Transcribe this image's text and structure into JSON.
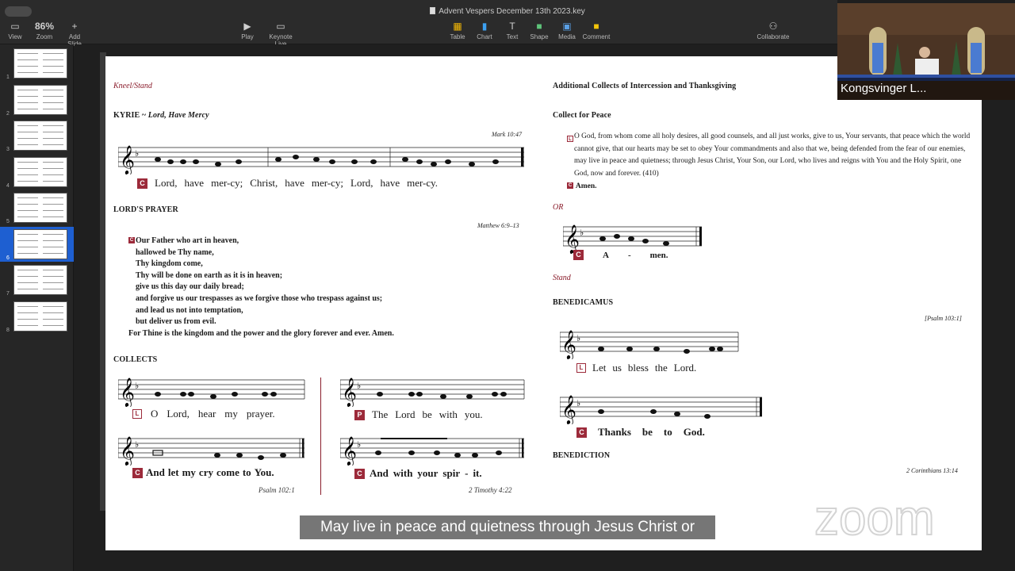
{
  "window": {
    "title": "Advent Vespers December 13th 2023.key"
  },
  "toolbar": {
    "view_label": "View",
    "zoom_value": "86%",
    "zoom_label": "Zoom",
    "add_slide_label": "Add Slide",
    "play_label": "Play",
    "keynote_live_label": "Keynote Live",
    "table_label": "Table",
    "chart_label": "Chart",
    "text_label": "Text",
    "shape_label": "Shape",
    "media_label": "Media",
    "comment_label": "Comment",
    "collaborate_label": "Collaborate"
  },
  "sidebar": {
    "slides": [
      {
        "num": "1",
        "selected": false
      },
      {
        "num": "2",
        "selected": false
      },
      {
        "num": "3",
        "selected": false
      },
      {
        "num": "4",
        "selected": false
      },
      {
        "num": "5",
        "selected": false
      },
      {
        "num": "6",
        "selected": true
      },
      {
        "num": "7",
        "selected": false
      },
      {
        "num": "8",
        "selected": false
      }
    ]
  },
  "slide": {
    "left": {
      "rubric_kneel": "Kneel/Stand",
      "kyrie_head": "KYRIE ~ ",
      "kyrie_sub": "Lord, Have Mercy",
      "kyrie_ref": "Mark 10:47",
      "kyrie_badge": "C",
      "kyrie_lyrics": [
        "Lord,",
        "have",
        "mer-cy;",
        "Christ,",
        "have",
        "mer-cy;",
        "Lord,",
        "have",
        "mer-cy."
      ],
      "lords_prayer_head": "LORD'S PRAYER",
      "lords_prayer_ref": "Matthew 6:9–13",
      "prayer_badge": "C",
      "prayer_lines": [
        "Our Father who art in heaven,",
        "hallowed be Thy name,",
        "Thy kingdom come,",
        "Thy will be done on earth as it is in heaven;",
        "give us this day our daily bread;",
        "and forgive us our trespasses as we forgive those who trespass against us;",
        "and lead us not into temptation,",
        "but deliver us from evil.",
        "For Thine is the kingdom and the power and the glory forever and ever. Amen."
      ],
      "collects_head": "COLLECTS",
      "collects_a": {
        "l_badge": "L",
        "l_words": [
          "O",
          "Lord,",
          "hear",
          "my",
          "prayer."
        ],
        "c_badge": "C",
        "c_words": [
          "And",
          "let",
          "my",
          "cry",
          "come",
          "to",
          "You."
        ],
        "ref": "Psalm 102:1"
      },
      "collects_b": {
        "p_badge": "P",
        "p_words": [
          "The",
          "Lord",
          "be",
          "with",
          "you."
        ],
        "c_badge": "C",
        "c_words": [
          "And",
          "with",
          "your",
          "spir",
          "-",
          "it."
        ],
        "ref": "2 Timothy 4:22"
      }
    },
    "right": {
      "additional_head": "Additional Collects of Intercession and Thanksgiving",
      "peace_head": "Collect for Peace",
      "peace_badge": "L",
      "peace_text": "O God, from whom come all holy desires, all good counsels, and all just works, give to us, Your servants, that peace which the world cannot give, that our hearts may be set to obey Your commandments and also that we, being defended from the fear of our enemies, may live in peace and quietness; through Jesus Christ, Your Son, our Lord, who lives and reigns with You and the Holy Spirit, one God, now and forever. (410)",
      "amen_badge": "C",
      "amen_text": "Amen.",
      "or_rubric": "OR",
      "amen_song_badge": "C",
      "amen_song_words": [
        "A",
        "-",
        "men."
      ],
      "stand_rubric": "Stand",
      "benedicamus_head": "BENEDICAMUS",
      "benedicamus_ref": "[Psalm 103:1]",
      "bless_badge": "L",
      "bless_words": [
        "Let",
        "us",
        "bless",
        "the",
        "Lord."
      ],
      "thanks_badge": "C",
      "thanks_words": [
        "Thanks",
        "be",
        "to",
        "God."
      ],
      "benediction_head": "BENEDICTION",
      "benediction_ref": "2 Corinthians 13:14"
    }
  },
  "webcam": {
    "participant_name": "Kongsvinger L..."
  },
  "caption": {
    "text": "May live in peace and quietness through Jesus Christ or"
  },
  "watermark": {
    "text": "zoom"
  }
}
